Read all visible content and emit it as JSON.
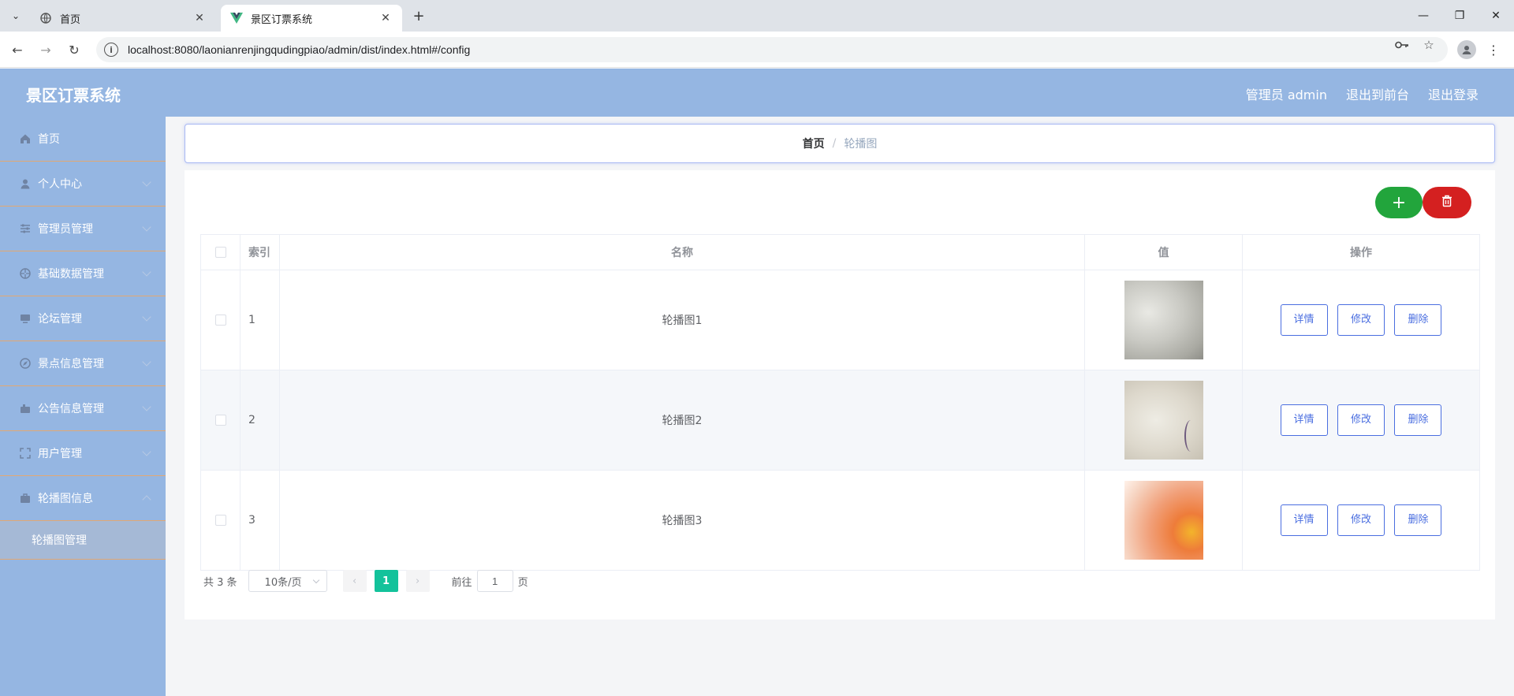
{
  "browser": {
    "tabs": [
      {
        "title": "首页",
        "active": false
      },
      {
        "title": "景区订票系统",
        "active": true
      }
    ],
    "url": "localhost:8080/laonianrenjingqudingpiao/admin/dist/index.html#/config"
  },
  "header": {
    "app_title": "景区订票系统",
    "user_label": "管理员 admin",
    "to_frontend": "退出到前台",
    "logout": "退出登录"
  },
  "sidebar": {
    "items": [
      {
        "label": "首页",
        "icon": "home-icon",
        "expandable": false
      },
      {
        "label": "个人中心",
        "icon": "user-icon",
        "expandable": true
      },
      {
        "label": "管理员管理",
        "icon": "sliders-icon",
        "expandable": true
      },
      {
        "label": "基础数据管理",
        "icon": "aperture-icon",
        "expandable": true
      },
      {
        "label": "论坛管理",
        "icon": "monitor-icon",
        "expandable": true
      },
      {
        "label": "景点信息管理",
        "icon": "compass-icon",
        "expandable": true
      },
      {
        "label": "公告信息管理",
        "icon": "suitcase-icon",
        "expandable": true
      },
      {
        "label": "用户管理",
        "icon": "fullscreen-icon",
        "expandable": true
      },
      {
        "label": "轮播图信息",
        "icon": "briefcase-icon",
        "expandable": true,
        "expanded": true
      }
    ],
    "submenu": {
      "label": "轮播图管理"
    }
  },
  "breadcrumb": {
    "home": "首页",
    "separator": "/",
    "current": "轮播图"
  },
  "actions": {
    "add": "+",
    "delete": "🗑"
  },
  "table": {
    "columns": [
      "索引",
      "名称",
      "值",
      "操作"
    ],
    "rows": [
      {
        "index": "1",
        "name": "轮播图1",
        "image": "gray-texture"
      },
      {
        "index": "2",
        "name": "轮播图2",
        "image": "beige-ink-painting"
      },
      {
        "index": "3",
        "name": "轮播图3",
        "image": "orange-blur"
      }
    ],
    "row_actions": {
      "detail": "详情",
      "edit": "修改",
      "delete": "删除"
    }
  },
  "pagination": {
    "total_text": "共 3 条",
    "page_size": "10条/页",
    "current_page": "1",
    "goto_label": "前往",
    "goto_value": "1",
    "page_unit": "页"
  },
  "colors": {
    "header_bg": "#95b6e2",
    "sidebar_bg": "#95b6e2",
    "add_btn": "#22a53c",
    "delete_btn": "#d42020",
    "active_page": "#13c29b",
    "link_blue": "#4a6ee0"
  }
}
